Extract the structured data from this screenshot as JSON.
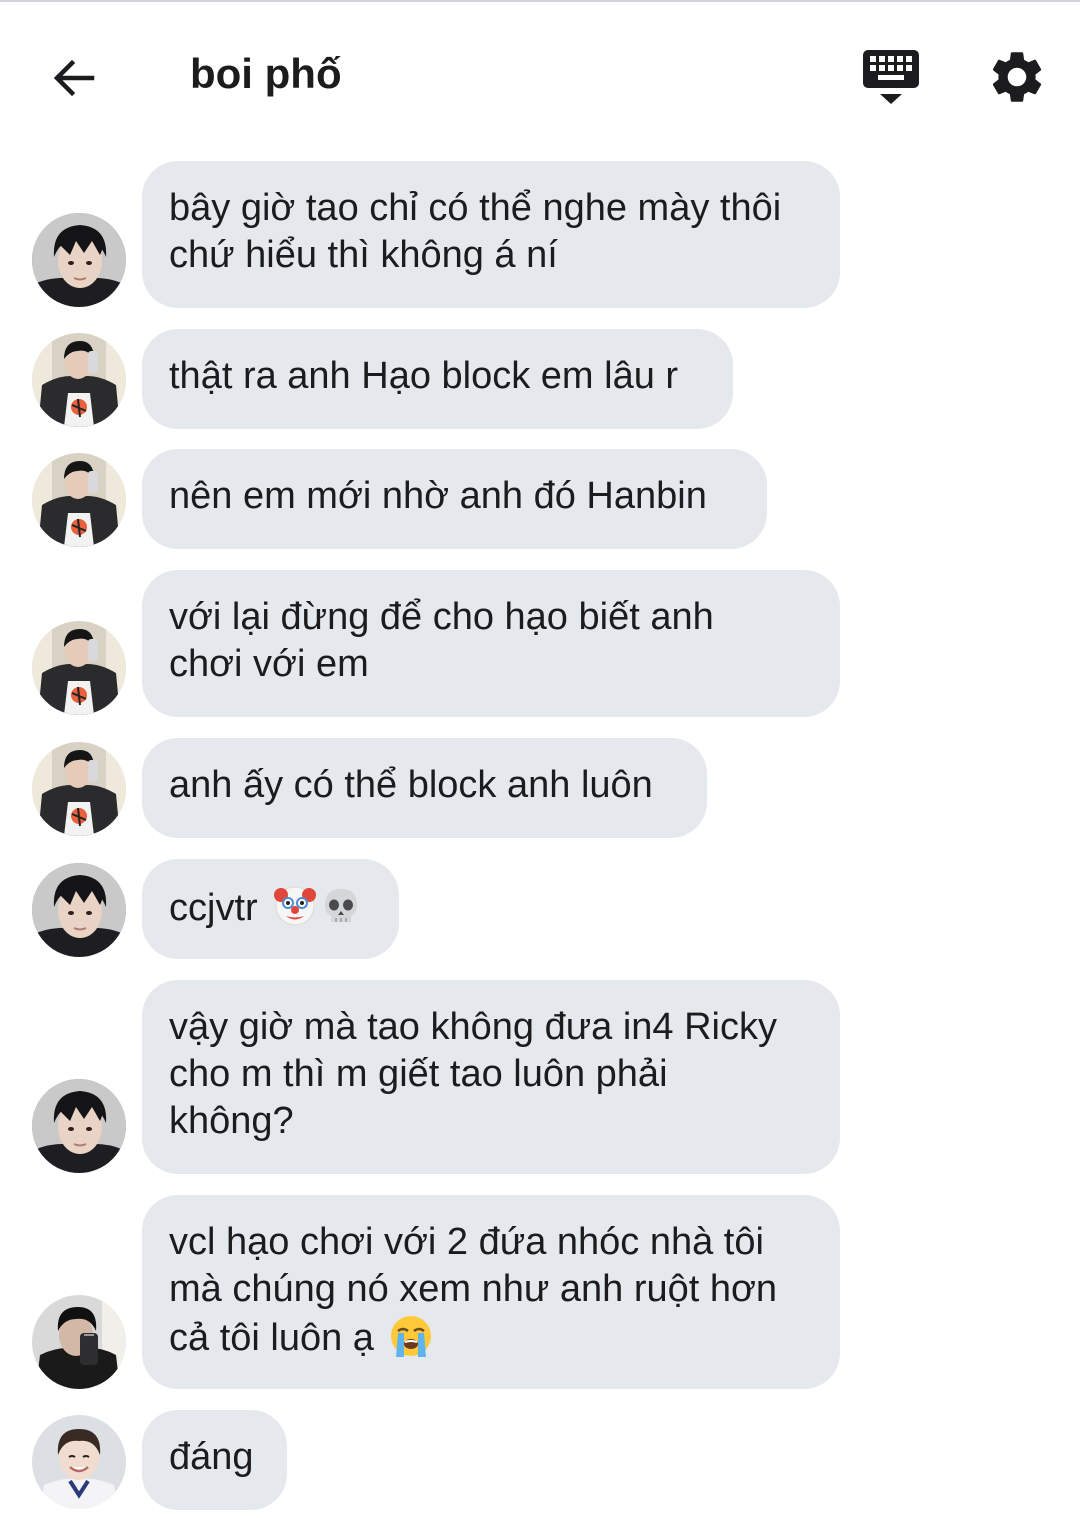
{
  "header": {
    "title": "boi phố",
    "back_icon": "arrow-left-icon",
    "keyboard_icon": "keyboard-hide-icon",
    "settings_icon": "gear-icon"
  },
  "colors": {
    "bubble": "#e5e8ed",
    "text": "#1c1c1e",
    "background": "#ffffff"
  },
  "messages": [
    {
      "text": "bây giờ tao chỉ có thể nghe mày thôi\nchứ hiểu thì không á ní",
      "avatar": "avatar-a"
    },
    {
      "text": "thật ra anh Hạo block em lâu r",
      "avatar": "avatar-b"
    },
    {
      "text": "nên em mới nhờ anh đó Hanbin",
      "avatar": "avatar-b"
    },
    {
      "text": "với lại đừng để cho hạo biết anh\nchơi với em",
      "avatar": "avatar-b"
    },
    {
      "text": "anh ấy có thể block anh luôn",
      "avatar": "avatar-b"
    },
    {
      "text": "ccjvtr",
      "avatar": "avatar-a",
      "emojis": [
        "clown-face-emoji",
        "skull-emoji"
      ]
    },
    {
      "text": "vậy giờ mà tao không đưa in4 Ricky\ncho m thì m giết tao luôn phải\nkhông?",
      "avatar": "avatar-a"
    },
    {
      "text": "vcl hạo chơi với 2 đứa nhóc nhà tôi\nmà chúng nó xem như anh ruột hơn\ncả tôi luôn ạ",
      "avatar": "avatar-c",
      "emojis": [
        "loudly-crying-face-emoji"
      ]
    },
    {
      "text": "đáng",
      "avatar": "avatar-d"
    }
  ]
}
